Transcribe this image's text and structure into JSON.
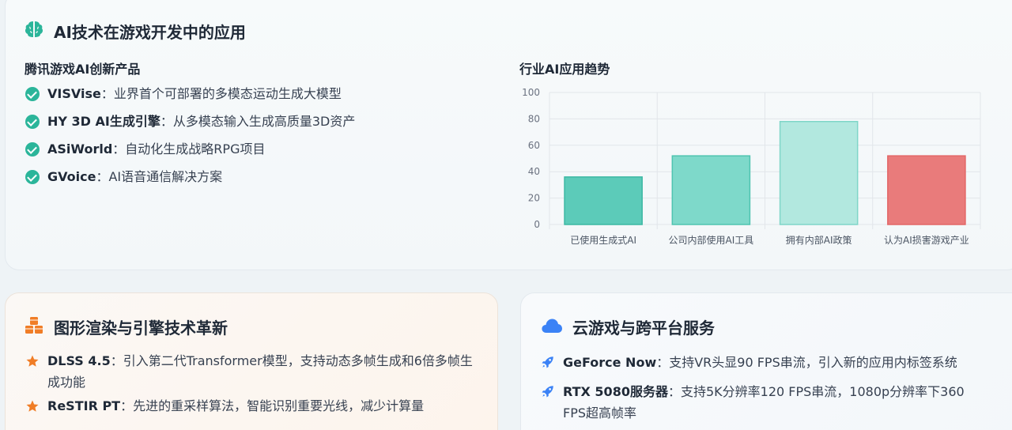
{
  "top_section": {
    "title": "AI技术在游戏开发中的应用",
    "icon": "brain-icon",
    "products": {
      "heading": "腾讯游戏AI创新产品",
      "items": [
        {
          "name": "VISVise",
          "desc": "：业界首个可部署的多模态运动生成大模型"
        },
        {
          "name": "HY 3D AI生成引擎",
          "desc": "：从多模态输入生成高质量3D资产"
        },
        {
          "name": "ASiWorld",
          "desc": "：自动化生成战略RPG项目"
        },
        {
          "name": "GVoice",
          "desc": "：AI语音通信解决方案"
        }
      ]
    },
    "trend": {
      "heading": "行业AI应用趋势"
    }
  },
  "chart_data": {
    "type": "bar",
    "title": "行业AI应用趋势",
    "categories": [
      "已使用生成式AI",
      "公司内部使用AI工具",
      "拥有内部AI政策",
      "认为AI损害游戏产业"
    ],
    "values": [
      36,
      52,
      78,
      52
    ],
    "colors": [
      "#5ccbb9",
      "#7ed9ca",
      "#b2e8df",
      "#e97b7b"
    ],
    "borders": [
      "#3bb8a3",
      "#4fc4b0",
      "#7fd6c8",
      "#e36767"
    ],
    "ylim": [
      0,
      100
    ],
    "yticks": [
      0,
      20,
      40,
      60,
      80,
      100
    ],
    "grid": true,
    "xlabel": "",
    "ylabel": ""
  },
  "rendering_section": {
    "title": "图形渲染与引擎技术革新",
    "icon": "cubes-icon",
    "items": [
      {
        "name": "DLSS 4.5",
        "desc": "：引入第二代Transformer模型，支持动态多帧生成和6倍多帧生成功能"
      },
      {
        "name": "ReSTIR PT",
        "desc": "：先进的重采样算法，智能识别重要光线，减少计算量"
      }
    ]
  },
  "cloud_section": {
    "title": "云游戏与跨平台服务",
    "icon": "cloud-icon",
    "items": [
      {
        "name": "GeForce Now",
        "desc": "：支持VR头显90 FPS串流，引入新的应用内标签系统"
      },
      {
        "name": "RTX 5080服务器",
        "desc": "：支持5K分辨率120 FPS串流，1080p分辨率下360 FPS超高帧率"
      }
    ]
  },
  "colors": {
    "accent_teal": "#2bb59a",
    "accent_orange": "#f07d26",
    "accent_blue": "#3b82f6"
  }
}
